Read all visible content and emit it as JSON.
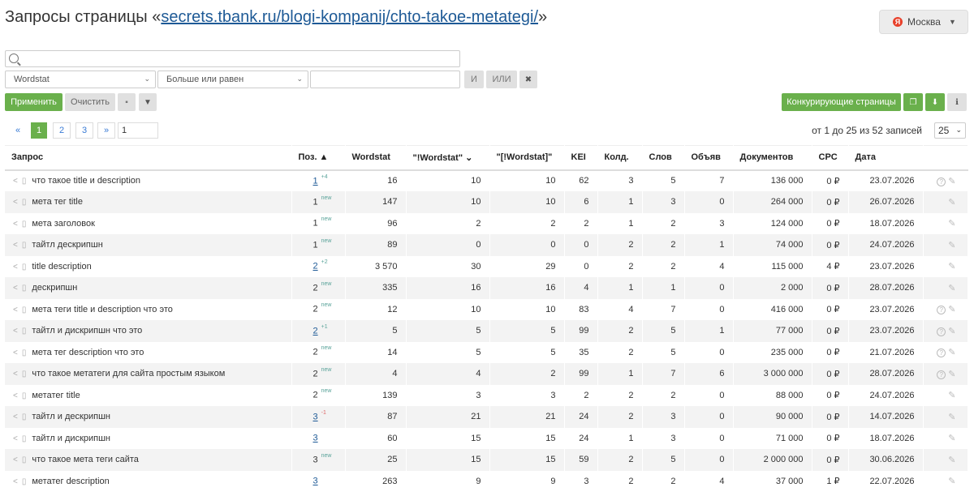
{
  "header": {
    "prefix": "Запросы страницы «",
    "url": "secrets.tbank.ru/blogi-kompanij/chto-takoe-metategi/",
    "suffix": "»",
    "region": "Москва",
    "region_icon": "Я"
  },
  "filters": {
    "search_placeholder": "",
    "source_select": "Wordstat",
    "condition_select": "Больше или равен",
    "value": "",
    "and_label": "И",
    "or_label": "ИЛИ",
    "remove_label": "✖"
  },
  "actions": {
    "apply": "Применить",
    "clear": "Очистить",
    "save_icon": "▪",
    "filter_icon": "▼",
    "competitors": "Конкурирующие страницы",
    "copy_icon": "❐",
    "download_icon": "⬇",
    "info_icon": "ℹ"
  },
  "pagination": {
    "first": "«",
    "pages": [
      "1",
      "2",
      "3"
    ],
    "next": "»",
    "page_input": "1",
    "records": "от 1 до 25 из 52 записей",
    "per_page": "25"
  },
  "table": {
    "headers": {
      "query": "Запрос",
      "pos": "Поз. ▲",
      "wordstat": "Wordstat",
      "excl_wordstat": "\"!Wordstat\" ⌄",
      "bracket_wordstat": "\"[!Wordstat]\"",
      "kei": "KEI",
      "qty": "Колд.",
      "words": "Слов",
      "ads": "Объяв",
      "docs": "Документов",
      "cpc": "CPC",
      "date": "Дата"
    },
    "rows": [
      {
        "q": "что такое title и description",
        "pos": "1",
        "link": true,
        "delta": "+4",
        "ws": "16",
        "ews": "10",
        "bws": "10",
        "kei": "62",
        "qty": "3",
        "words": "5",
        "ads": "7",
        "docs": "136 000",
        "cpc": "0 ₽",
        "date": "23.07.2026",
        "help": true
      },
      {
        "q": "мета тег title",
        "pos": "1",
        "link": false,
        "delta": "new",
        "ws": "147",
        "ews": "10",
        "bws": "10",
        "kei": "6",
        "qty": "1",
        "words": "3",
        "ads": "0",
        "docs": "264 000",
        "cpc": "0 ₽",
        "date": "26.07.2026",
        "help": false
      },
      {
        "q": "мета заголовок",
        "pos": "1",
        "link": false,
        "delta": "new",
        "ws": "96",
        "ews": "2",
        "bws": "2",
        "kei": "2",
        "qty": "1",
        "words": "2",
        "ads": "3",
        "docs": "124 000",
        "cpc": "0 ₽",
        "date": "18.07.2026",
        "help": false
      },
      {
        "q": "тайтл дескрипшн",
        "pos": "1",
        "link": false,
        "delta": "new",
        "ws": "89",
        "ews": "0",
        "bws": "0",
        "kei": "0",
        "qty": "2",
        "words": "2",
        "ads": "1",
        "docs": "74 000",
        "cpc": "0 ₽",
        "date": "24.07.2026",
        "help": false
      },
      {
        "q": "title description",
        "pos": "2",
        "link": true,
        "delta": "+2",
        "ws": "3 570",
        "ews": "30",
        "bws": "29",
        "kei": "0",
        "qty": "2",
        "words": "2",
        "ads": "4",
        "docs": "115 000",
        "cpc": "4 ₽",
        "date": "23.07.2026",
        "help": false
      },
      {
        "q": "дескрипшн",
        "pos": "2",
        "link": false,
        "delta": "new",
        "ws": "335",
        "ews": "16",
        "bws": "16",
        "kei": "4",
        "qty": "1",
        "words": "1",
        "ads": "0",
        "docs": "2 000",
        "cpc": "0 ₽",
        "date": "28.07.2026",
        "help": false
      },
      {
        "q": "мета теги title и description что это",
        "pos": "2",
        "link": false,
        "delta": "new",
        "ws": "12",
        "ews": "10",
        "bws": "10",
        "kei": "83",
        "qty": "4",
        "words": "7",
        "ads": "0",
        "docs": "416 000",
        "cpc": "0 ₽",
        "date": "23.07.2026",
        "help": true
      },
      {
        "q": "тайтл и дискрипшн что это",
        "pos": "2",
        "link": true,
        "delta": "+1",
        "ws": "5",
        "ews": "5",
        "bws": "5",
        "kei": "99",
        "qty": "2",
        "words": "5",
        "ads": "1",
        "docs": "77 000",
        "cpc": "0 ₽",
        "date": "23.07.2026",
        "help": true
      },
      {
        "q": "мета тег description что это",
        "pos": "2",
        "link": false,
        "delta": "new",
        "ws": "14",
        "ews": "5",
        "bws": "5",
        "kei": "35",
        "qty": "2",
        "words": "5",
        "ads": "0",
        "docs": "235 000",
        "cpc": "0 ₽",
        "date": "21.07.2026",
        "help": true
      },
      {
        "q": "что такое метатеги для сайта простым языком",
        "pos": "2",
        "link": false,
        "delta": "new",
        "ws": "4",
        "ews": "4",
        "bws": "2",
        "kei": "99",
        "qty": "1",
        "words": "7",
        "ads": "6",
        "docs": "3 000 000",
        "cpc": "0 ₽",
        "date": "28.07.2026",
        "help": true
      },
      {
        "q": "метатег title",
        "pos": "2",
        "link": false,
        "delta": "new",
        "ws": "139",
        "ews": "3",
        "bws": "3",
        "kei": "2",
        "qty": "2",
        "words": "2",
        "ads": "0",
        "docs": "88 000",
        "cpc": "0 ₽",
        "date": "24.07.2026",
        "help": false
      },
      {
        "q": "тайтл и дескрипшн",
        "pos": "3",
        "link": true,
        "delta": "-1",
        "ws": "87",
        "ews": "21",
        "bws": "21",
        "kei": "24",
        "qty": "2",
        "words": "3",
        "ads": "0",
        "docs": "90 000",
        "cpc": "0 ₽",
        "date": "14.07.2026",
        "help": false
      },
      {
        "q": "тайтл и дискрипшн",
        "pos": "3",
        "link": true,
        "delta": "",
        "ws": "60",
        "ews": "15",
        "bws": "15",
        "kei": "24",
        "qty": "1",
        "words": "3",
        "ads": "0",
        "docs": "71 000",
        "cpc": "0 ₽",
        "date": "18.07.2026",
        "help": false
      },
      {
        "q": "что такое мета теги сайта",
        "pos": "3",
        "link": false,
        "delta": "new",
        "ws": "25",
        "ews": "15",
        "bws": "15",
        "kei": "59",
        "qty": "2",
        "words": "5",
        "ads": "0",
        "docs": "2 000 000",
        "cpc": "0 ₽",
        "date": "30.06.2026",
        "help": false
      },
      {
        "q": "метатег description",
        "pos": "3",
        "link": true,
        "delta": "",
        "ws": "263",
        "ews": "9",
        "bws": "9",
        "kei": "3",
        "qty": "2",
        "words": "2",
        "ads": "4",
        "docs": "37 000",
        "cpc": "1 ₽",
        "date": "22.07.2026",
        "help": false
      }
    ]
  }
}
